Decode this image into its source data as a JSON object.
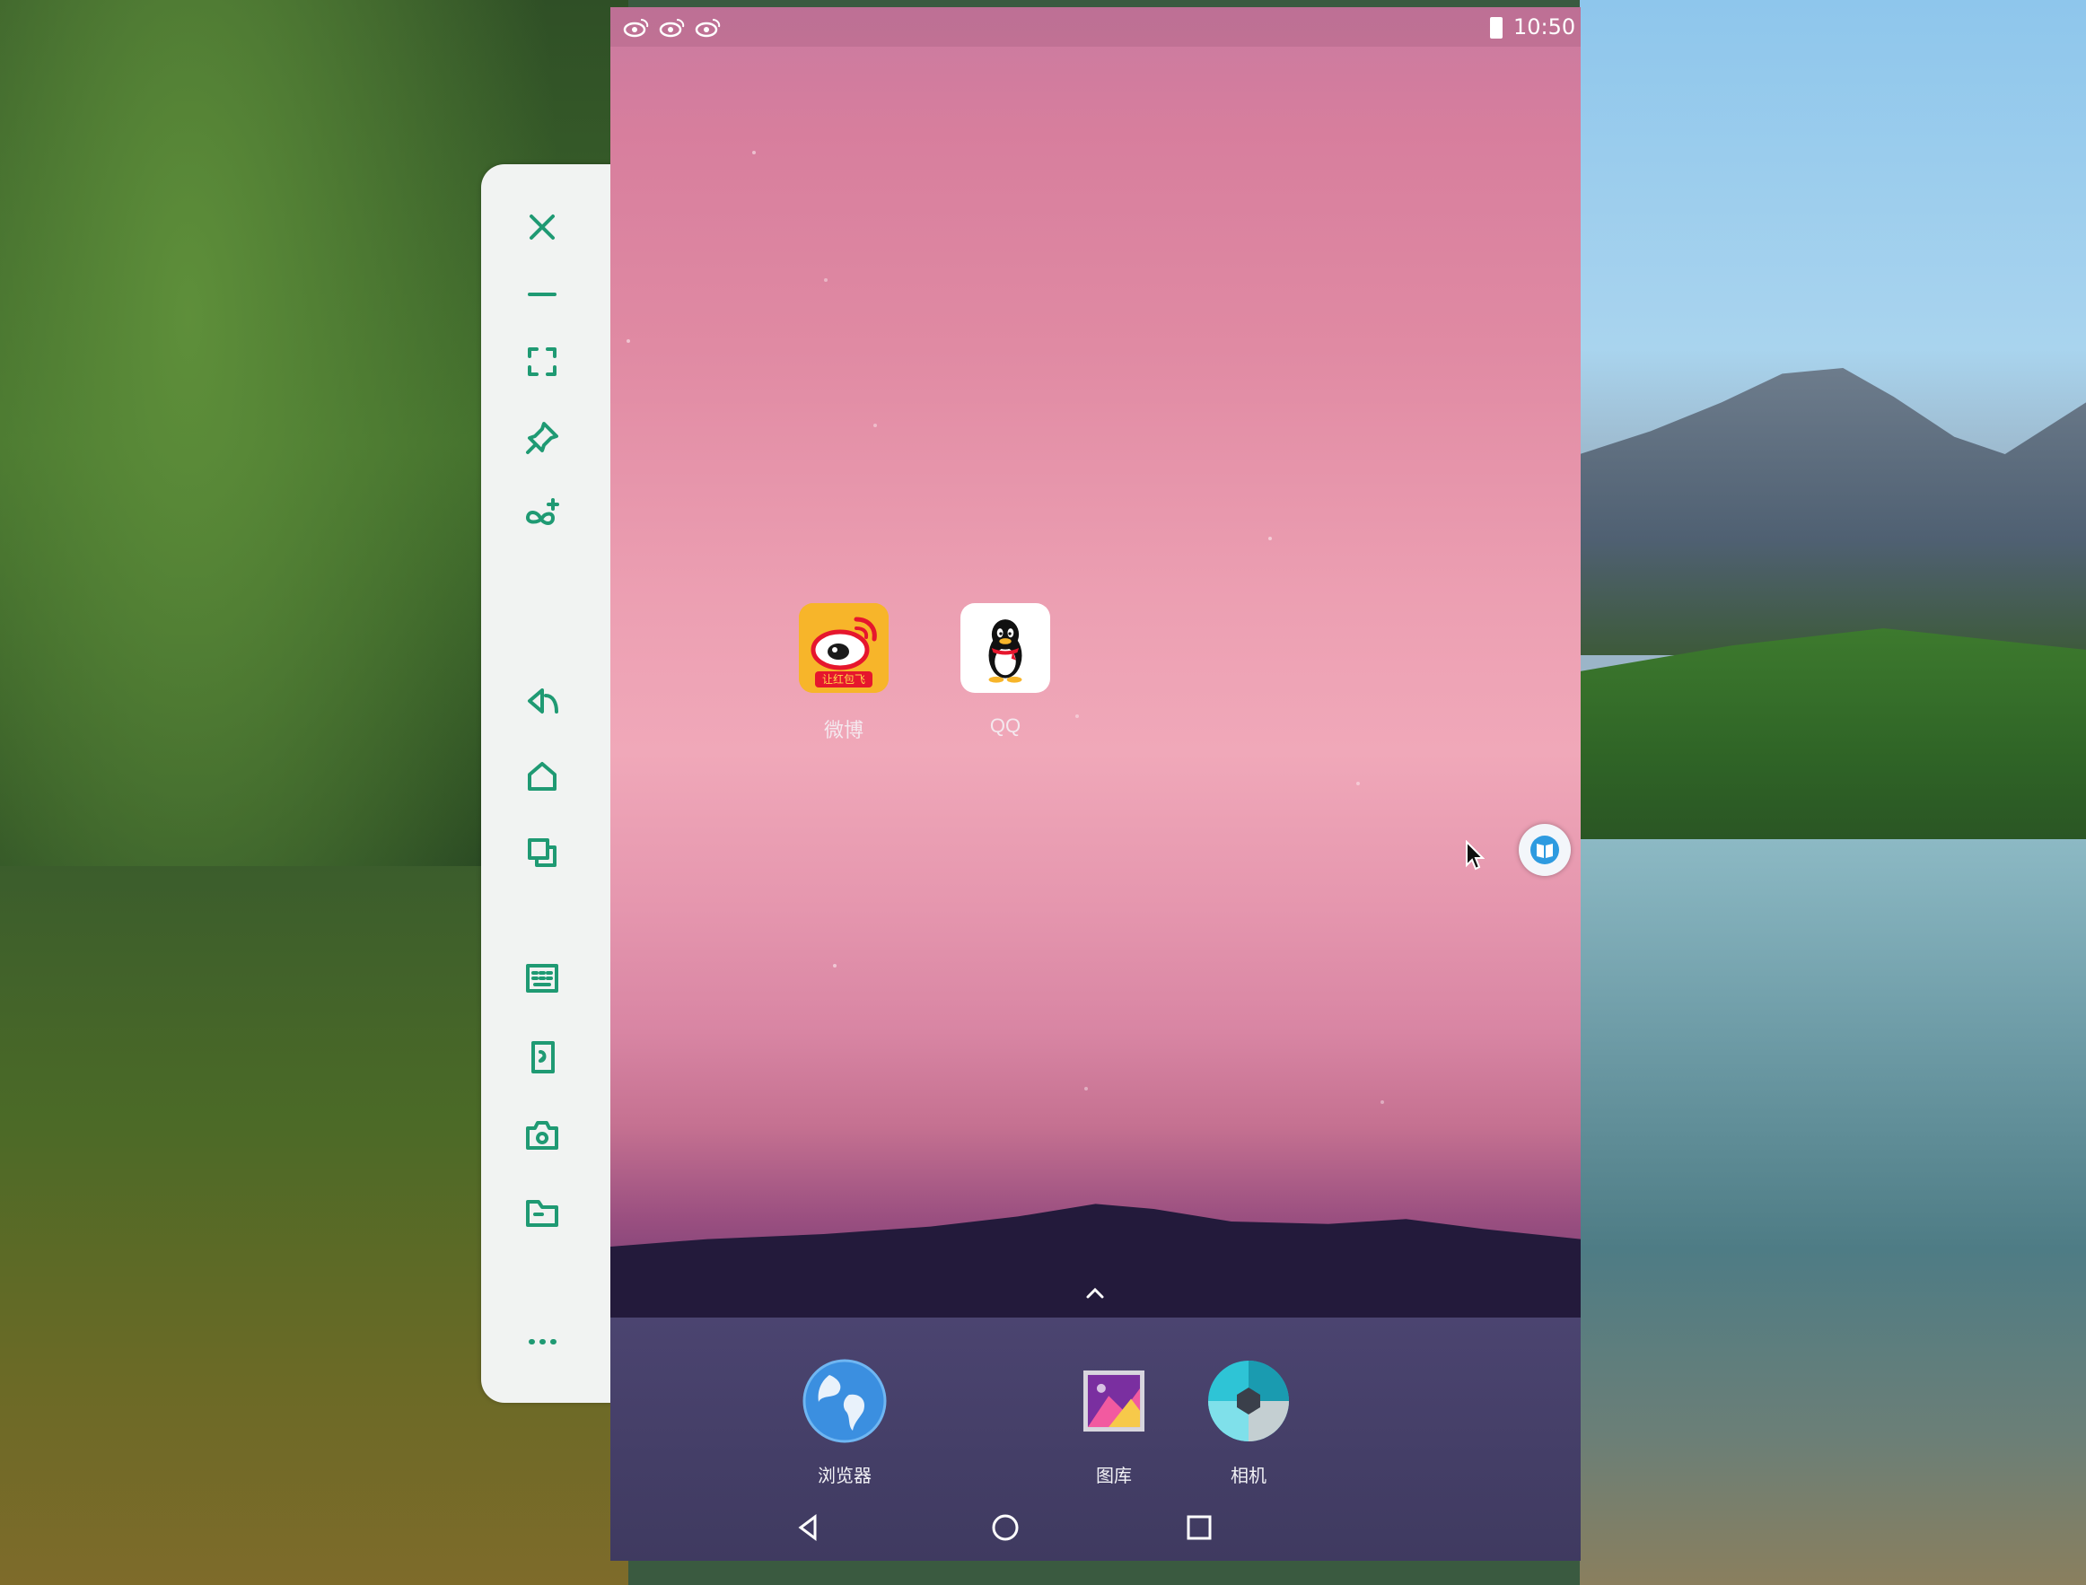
{
  "status_bar": {
    "notification_icons": [
      "weibo-icon",
      "weibo-icon",
      "weibo-icon"
    ],
    "battery_icon": "battery-icon",
    "time": "10:50"
  },
  "toolbar": {
    "buttons": [
      {
        "name": "close-button",
        "icon": "close-icon"
      },
      {
        "name": "minimize-button",
        "icon": "minus-icon"
      },
      {
        "name": "fullscreen-button",
        "icon": "fullscreen-icon"
      },
      {
        "name": "pin-button",
        "icon": "pin-icon"
      },
      {
        "name": "multi-open-button",
        "icon": "infinity-plus-icon"
      },
      {
        "name": "back-button",
        "icon": "back-icon"
      },
      {
        "name": "home-button",
        "icon": "home-icon"
      },
      {
        "name": "recents-button",
        "icon": "recents-icon"
      },
      {
        "name": "keyboard-button",
        "icon": "keyboard-icon"
      },
      {
        "name": "rotate-button",
        "icon": "rotate-icon"
      },
      {
        "name": "screenshot-button",
        "icon": "camera-icon"
      },
      {
        "name": "files-button",
        "icon": "folder-icon"
      },
      {
        "name": "more-button",
        "icon": "more-icon"
      }
    ]
  },
  "home_apps": [
    {
      "label": "微博",
      "icon": "weibo-app-icon",
      "badge": "让红包飞"
    },
    {
      "label": "QQ",
      "icon": "qq-app-icon"
    }
  ],
  "dock": [
    {
      "label": "浏览器",
      "icon": "browser-icon"
    },
    {
      "label": "图库",
      "icon": "gallery-icon"
    },
    {
      "label": "相机",
      "icon": "camera-app-icon"
    }
  ],
  "nav_bar": [
    "back-nav-icon",
    "home-nav-icon",
    "recents-nav-icon"
  ],
  "colors": {
    "toolbar_accent": "#1f9a73",
    "toolbar_bg": "#f1f3f2",
    "dock_bg": "#433d65",
    "weibo_bg": "#f7b52a",
    "weibo_red": "#e6162d"
  }
}
